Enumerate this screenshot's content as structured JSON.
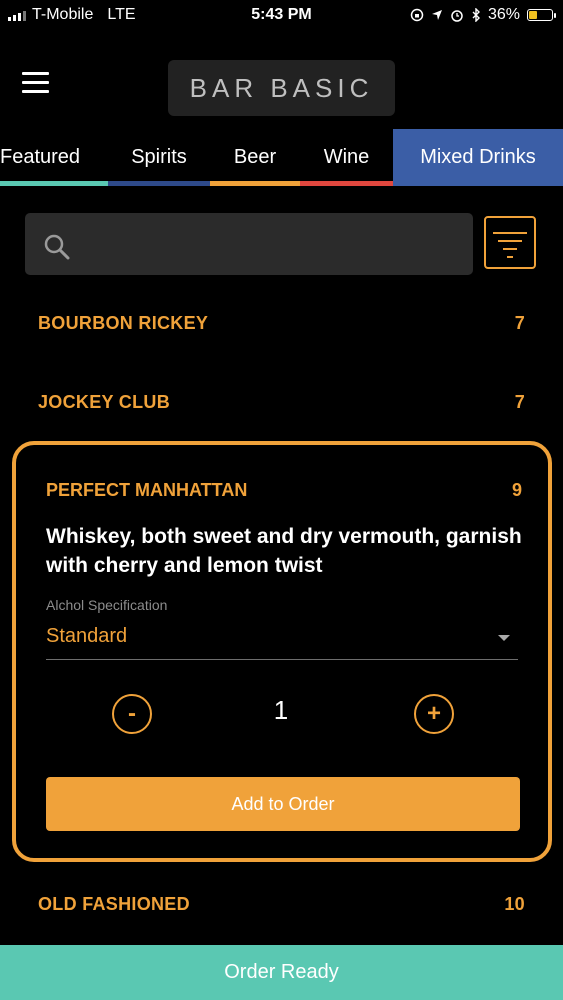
{
  "status_bar": {
    "carrier": "T-Mobile",
    "network": "LTE",
    "time": "5:43 PM",
    "battery": "36%",
    "battery_level": 0.36
  },
  "header": {
    "logo": "BAR BASIC"
  },
  "tabs": [
    {
      "label": "Featured",
      "color": "#5ac8b2",
      "active": false
    },
    {
      "label": "Spirits",
      "color": "#2e4a8a",
      "active": false
    },
    {
      "label": "Beer",
      "color": "#f0a23a",
      "active": false
    },
    {
      "label": "Wine",
      "color": "#e0473e",
      "active": false
    },
    {
      "label": "Mixed Drinks",
      "color": "#3b5ea6",
      "active": true
    }
  ],
  "search": {
    "value": "",
    "placeholder": ""
  },
  "drinks": [
    {
      "name": "BOURBON RICKEY",
      "price": "7"
    },
    {
      "name": "JOCKEY CLUB",
      "price": "7"
    },
    {
      "name": "OLD FASHIONED",
      "price": "10"
    }
  ],
  "selected_drink": {
    "name": "PERFECT MANHATTAN",
    "price": "9",
    "description": "Whiskey, both sweet and dry vermouth, garnish with cherry and lemon twist",
    "spec_label": "Alchol Specification",
    "spec_value": "Standard",
    "minus": "-",
    "plus": "+",
    "quantity": "1",
    "add_label": "Add to Order"
  },
  "footer": {
    "order_ready": "Order Ready"
  },
  "colors": {
    "accent": "#f0a23a",
    "teal": "#5ac8b2",
    "blue": "#3b5ea6"
  }
}
